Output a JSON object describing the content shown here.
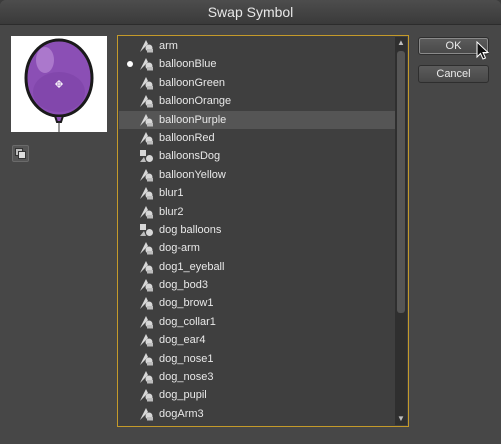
{
  "window": {
    "title": "Swap Symbol"
  },
  "buttons": {
    "ok_label": "OK",
    "cancel_label": "Cancel"
  },
  "symbols": [
    {
      "label": "arm",
      "icon": "graphic-symbol-icon",
      "current": false,
      "selected": false
    },
    {
      "label": "balloonBlue",
      "icon": "graphic-symbol-icon",
      "current": true,
      "selected": false
    },
    {
      "label": "balloonGreen",
      "icon": "graphic-symbol-icon",
      "current": false,
      "selected": false
    },
    {
      "label": "balloonOrange",
      "icon": "graphic-symbol-icon",
      "current": false,
      "selected": false
    },
    {
      "label": "balloonPurple",
      "icon": "graphic-symbol-icon",
      "current": false,
      "selected": true
    },
    {
      "label": "balloonRed",
      "icon": "graphic-symbol-icon",
      "current": false,
      "selected": false
    },
    {
      "label": "balloonsDog",
      "icon": "movieclip-symbol-icon",
      "current": false,
      "selected": false
    },
    {
      "label": "balloonYellow",
      "icon": "graphic-symbol-icon",
      "current": false,
      "selected": false
    },
    {
      "label": "blur1",
      "icon": "graphic-symbol-icon",
      "current": false,
      "selected": false
    },
    {
      "label": "blur2",
      "icon": "graphic-symbol-icon",
      "current": false,
      "selected": false
    },
    {
      "label": "dog balloons",
      "icon": "movieclip-symbol-icon",
      "current": false,
      "selected": false
    },
    {
      "label": "dog-arm",
      "icon": "graphic-symbol-icon",
      "current": false,
      "selected": false
    },
    {
      "label": "dog1_eyeball",
      "icon": "graphic-symbol-icon",
      "current": false,
      "selected": false
    },
    {
      "label": "dog_bod3",
      "icon": "graphic-symbol-icon",
      "current": false,
      "selected": false
    },
    {
      "label": "dog_brow1",
      "icon": "graphic-symbol-icon",
      "current": false,
      "selected": false
    },
    {
      "label": "dog_collar1",
      "icon": "graphic-symbol-icon",
      "current": false,
      "selected": false
    },
    {
      "label": "dog_ear4",
      "icon": "graphic-symbol-icon",
      "current": false,
      "selected": false
    },
    {
      "label": "dog_nose1",
      "icon": "graphic-symbol-icon",
      "current": false,
      "selected": false
    },
    {
      "label": "dog_nose3",
      "icon": "graphic-symbol-icon",
      "current": false,
      "selected": false
    },
    {
      "label": "dog_pupil",
      "icon": "graphic-symbol-icon",
      "current": false,
      "selected": false
    },
    {
      "label": "dogArm3",
      "icon": "graphic-symbol-icon",
      "current": false,
      "selected": false
    }
  ],
  "colors": {
    "focus_border": "#c49a2a",
    "selected_row": "#555555",
    "balloon_fill": "#8b4fb5"
  }
}
